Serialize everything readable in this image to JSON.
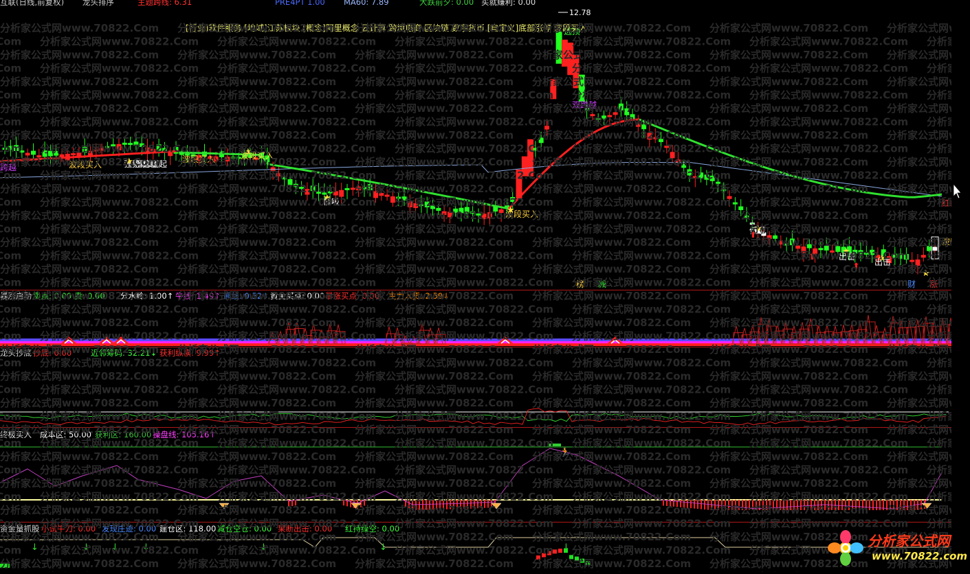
{
  "top_bar": {
    "items": [
      {
        "text": "互联(日线,前复权)",
        "color": "#cccccc"
      },
      {
        "text": "龙头排序",
        "color": "#cccccc"
      },
      {
        "text": "主题跨线: 6.31",
        "color": "#ff3030"
      },
      {
        "text": "PRE4PT 1.00",
        "color": "#4a6aff"
      },
      {
        "text": "MA60: 7.89",
        "color": "#9ab8ff"
      },
      {
        "text": "大跌前夕: 0.00",
        "color": "#40d040"
      },
      {
        "text": "买就赚利: 0.00",
        "color": "#e0e0e0"
      }
    ]
  },
  "main_chart": {
    "concept_text": "[行业]软件服务 [地域]江苏板块 [概念]阿里概念 云计算 跨境电商 区块链 数字货币 [自定义]底部涨停 波段买入",
    "high_label": "12.78",
    "annotations": [
      {
        "text": "逃顶",
        "color": "#40ff40"
      },
      {
        "text": "双跨越",
        "color": "#d040ff"
      },
      {
        "text": "波段买入",
        "color": "#ffd040"
      },
      {
        "text": "强势崛起",
        "color": "#ffffff"
      },
      {
        "text": "低吸",
        "color": "#ffffff"
      },
      {
        "text": "红K里",
        "color": "#ff3030"
      },
      {
        "text": "出击",
        "color": "#ffffff"
      },
      {
        "text": "财",
        "color": "#4a8aff"
      },
      {
        "text": "涨",
        "color": "#ff3030"
      },
      {
        "text": "减",
        "color": "#40ff40"
      },
      {
        "text": "榜",
        "color": "#ffd040"
      },
      {
        "text": "跨越",
        "color": "#d040ff"
      }
    ]
  },
  "panel2": {
    "name": "暴涨启动",
    "items": [
      {
        "text": "卖点: 0.00",
        "color": "#40ff40"
      },
      {
        "text": "卖: 0.00",
        "color": "#40ff40"
      },
      {
        "text": "分水岭: 1.00↑",
        "color": "#ffffff"
      },
      {
        "text": "牛线: 1.49↑",
        "color": "#ff40ff"
      },
      {
        "text": "熊线: 0.52↓",
        "color": "#4a8aff"
      },
      {
        "text": "黄金买点: 0.00",
        "color": "#ffffff"
      },
      {
        "text": "暴涨买点: 0.00",
        "color": "#ff3030"
      },
      {
        "text": "主力入货: 2.59↓",
        "color": "#ff8a00"
      }
    ]
  },
  "panel3": {
    "name": "龙头抄底",
    "items": [
      {
        "text": "抄底: 0.00",
        "color": "#ff3030"
      },
      {
        "text": "近邻筹码: 32.21↓",
        "color": "#40ff40"
      },
      {
        "text": "获利纵横: 9.99↑",
        "color": "#ff3030"
      }
    ]
  },
  "panel4": {
    "name": "终极买入",
    "items": [
      {
        "text": "成本区: 50.00",
        "color": "#ffffff"
      },
      {
        "text": "获利区: 160.00",
        "color": "#40c040"
      },
      {
        "text": "操盘线: 105.16↑",
        "color": "#ff40ff"
      }
    ]
  },
  "panel5": {
    "name": "资金量抓股",
    "items": [
      {
        "text": "小试牛刀: 0.00",
        "color": "#ff3030"
      },
      {
        "text": "发现庄迹: 0.00",
        "color": "#4a8aff"
      },
      {
        "text": "建仓区: 118.00",
        "color": "#ffffff"
      },
      {
        "text": "减仓空仓: 0.00",
        "color": "#40ff40"
      },
      {
        "text": "果断出击: 0.00",
        "color": "#ff3030"
      },
      {
        "text": "红持绿空: 0.00",
        "color": "#40ff40"
      }
    ]
  },
  "watermark": {
    "text": "分析家公式网www.70822.Com"
  },
  "logo": {
    "title": "分析家公式网",
    "url": "www.70822.com"
  }
}
